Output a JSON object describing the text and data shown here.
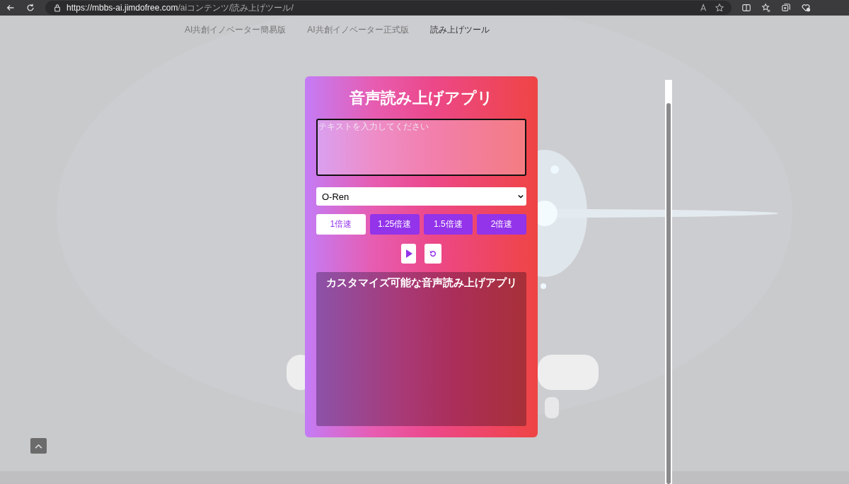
{
  "browser": {
    "url_host": "https://mbbs-ai.jimdofree.com",
    "url_path": "/aiコンテンツ/読み上げツール/"
  },
  "nav": [
    {
      "label": "AI共創イノベーター簡易版",
      "selected": false
    },
    {
      "label": "AI共創イノベーター正式版",
      "selected": false
    },
    {
      "label": "読み上げツール",
      "selected": true
    }
  ],
  "app": {
    "title": "音声読み上げアプリ",
    "text_input": {
      "placeholder": "テキストを入力してください"
    },
    "voice_select": {
      "value": "O-Ren"
    },
    "speeds": [
      {
        "label": "1倍速",
        "selected": true
      },
      {
        "label": "1.25倍速",
        "selected": false
      },
      {
        "label": "1.5倍速",
        "selected": false
      },
      {
        "label": "2倍速",
        "selected": false
      }
    ],
    "output": {
      "heading": "カスタマイズ可能な音声読み上げアプリ"
    }
  }
}
